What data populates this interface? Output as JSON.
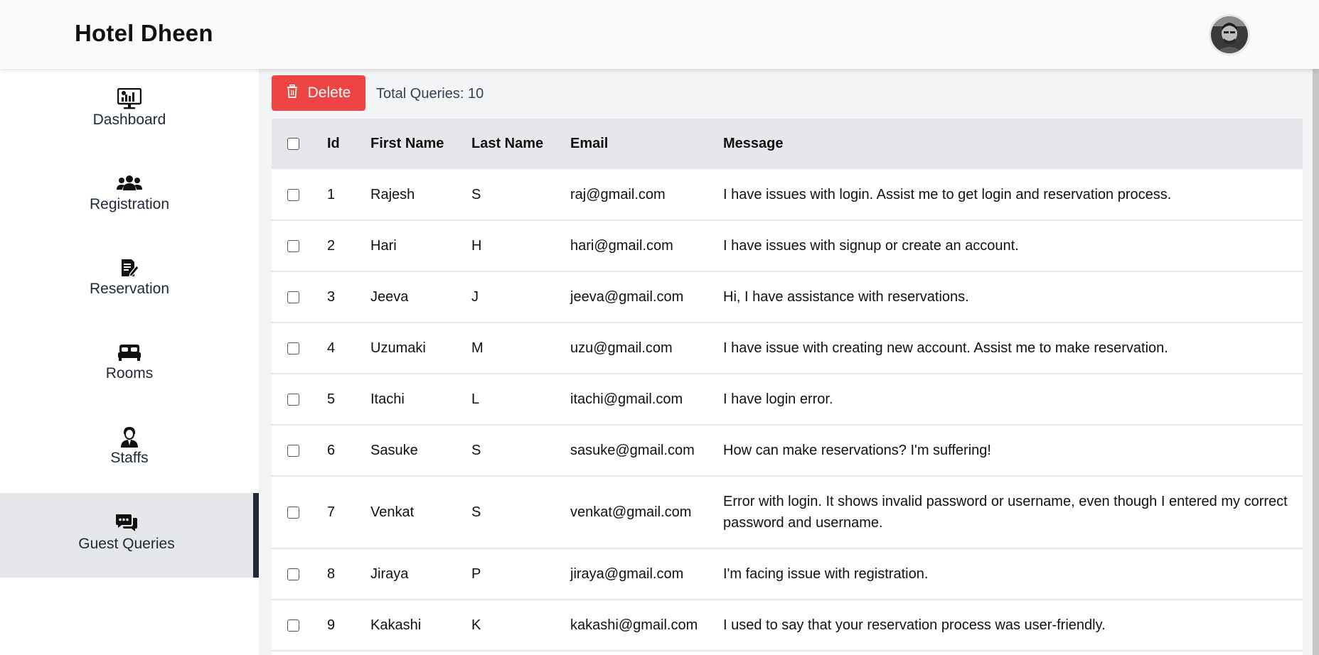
{
  "header": {
    "title": "Hotel Dheen",
    "avatar_icon": "user-avatar-icon"
  },
  "sidebar": {
    "items": [
      {
        "label": "Dashboard",
        "icon": "dashboard-monitor-icon",
        "active": false
      },
      {
        "label": "Registration",
        "icon": "users-group-icon",
        "active": false
      },
      {
        "label": "Reservation",
        "icon": "document-edit-icon",
        "active": false
      },
      {
        "label": "Rooms",
        "icon": "bed-icon",
        "active": false
      },
      {
        "label": "Staffs",
        "icon": "staff-person-icon",
        "active": false
      },
      {
        "label": "Guest Queries",
        "icon": "chat-bubbles-icon",
        "active": true
      }
    ]
  },
  "toolbar": {
    "delete_label": "Delete",
    "total_label": "Total Queries: 10"
  },
  "table": {
    "columns": [
      "Id",
      "First Name",
      "Last Name",
      "Email",
      "Message"
    ],
    "rows": [
      {
        "id": "1",
        "first": "Rajesh",
        "last": "S",
        "email": "raj@gmail.com",
        "message": "I have issues with login. Assist me to get login and reservation process."
      },
      {
        "id": "2",
        "first": "Hari",
        "last": "H",
        "email": "hari@gmail.com",
        "message": "I have issues with signup or create an account."
      },
      {
        "id": "3",
        "first": "Jeeva",
        "last": "J",
        "email": "jeeva@gmail.com",
        "message": "Hi, I have assistance with reservations."
      },
      {
        "id": "4",
        "first": "Uzumaki",
        "last": "M",
        "email": "uzu@gmail.com",
        "message": "I have issue with creating new account. Assist me to make reservation."
      },
      {
        "id": "5",
        "first": "Itachi",
        "last": "L",
        "email": "itachi@gmail.com",
        "message": "I have login error."
      },
      {
        "id": "6",
        "first": "Sasuke",
        "last": "S",
        "email": "sasuke@gmail.com",
        "message": "How can make reservations? I'm suffering!"
      },
      {
        "id": "7",
        "first": "Venkat",
        "last": "S",
        "email": "venkat@gmail.com",
        "message": "Error with login. It shows invalid password or username, even though I entered my correct password and username."
      },
      {
        "id": "8",
        "first": "Jiraya",
        "last": "P",
        "email": "jiraya@gmail.com",
        "message": "I'm facing issue with registration."
      },
      {
        "id": "9",
        "first": "Kakashi",
        "last": "K",
        "email": "kakashi@gmail.com",
        "message": "I used to say that your reservation process was user-friendly."
      }
    ]
  },
  "colors": {
    "delete_button": "#ef4444",
    "active_nav_bg": "#e5e7eb",
    "header_row_bg": "#e5e7eb",
    "topbar_bg": "#f9fafb"
  }
}
